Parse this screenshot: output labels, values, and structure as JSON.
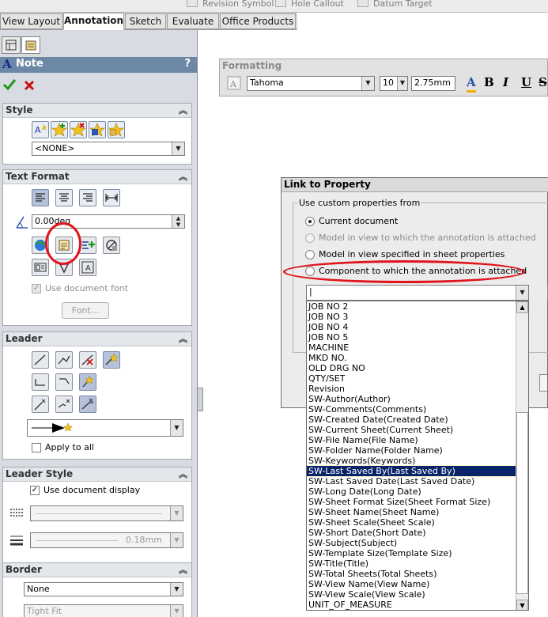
{
  "top_toolbar": {
    "items": [
      "Revision Symbol",
      "Hole Callout",
      "Datum Target"
    ]
  },
  "tabs": [
    "View Layout",
    "Annotation",
    "Sketch",
    "Evaluate",
    "Office Products"
  ],
  "panel": {
    "title": "Note",
    "help": "?",
    "style": {
      "header": "Style",
      "value": "<NONE>"
    },
    "text_format": {
      "header": "Text Format",
      "angle_value": "0.00deg",
      "use_doc_font": "Use document font",
      "font_button": "Font..."
    },
    "leader": {
      "header": "Leader",
      "apply_all": "Apply to all"
    },
    "leader_style": {
      "header": "Leader Style",
      "use_doc_display": "Use document display",
      "thickness_value": "0.18mm"
    },
    "border": {
      "header": "Border",
      "style_value": "None",
      "size_value": "Tight Fit"
    }
  },
  "formatting": {
    "title": "Formatting",
    "font": "Tahoma",
    "size": "10",
    "height": "2.75mm",
    "buttons": [
      "A",
      "B",
      "I",
      "U",
      "S"
    ]
  },
  "dialog": {
    "title": "Link to Property",
    "group_label": "Use custom properties from",
    "options": [
      "Current document",
      "Model in view to which the annotation is attached",
      "Model in view specified in sheet properties",
      "Component to which the annotation is attached"
    ],
    "combo_value": "|",
    "list_items": [
      "JOB NO 2",
      "JOB NO 3",
      "JOB NO 4",
      "JOB NO 5",
      "MACHINE",
      "MKD NO.",
      "OLD DRG NO",
      "QTY/SET",
      "Revision",
      "SW-Author(Author)",
      "SW-Comments(Comments)",
      "SW-Created Date(Created Date)",
      "SW-Current Sheet(Current Sheet)",
      "SW-File Name(File Name)",
      "SW-Folder Name(Folder Name)",
      "SW-Keywords(Keywords)",
      "SW-Last Saved By(Last Saved By)",
      "SW-Last Saved Date(Last Saved Date)",
      "SW-Long Date(Long Date)",
      "SW-Sheet Format Size(Sheet Format Size)",
      "SW-Sheet Name(Sheet Name)",
      "SW-Sheet Scale(Sheet Scale)",
      "SW-Short Date(Short Date)",
      "SW-Subject(Subject)",
      "SW-Template Size(Template Size)",
      "SW-Title(Title)",
      "SW-Total Sheets(Total Sheets)",
      "SW-View Name(View Name)",
      "SW-View Scale(View Scale)",
      "UNIT_OF_MEASURE"
    ],
    "selected_item": "SW-Last Saved By(Last Saved By)"
  },
  "colors": {
    "title_bar": "#6d87a7",
    "selection": "#0a246a",
    "highlight_ellipse": "#e0141c"
  }
}
